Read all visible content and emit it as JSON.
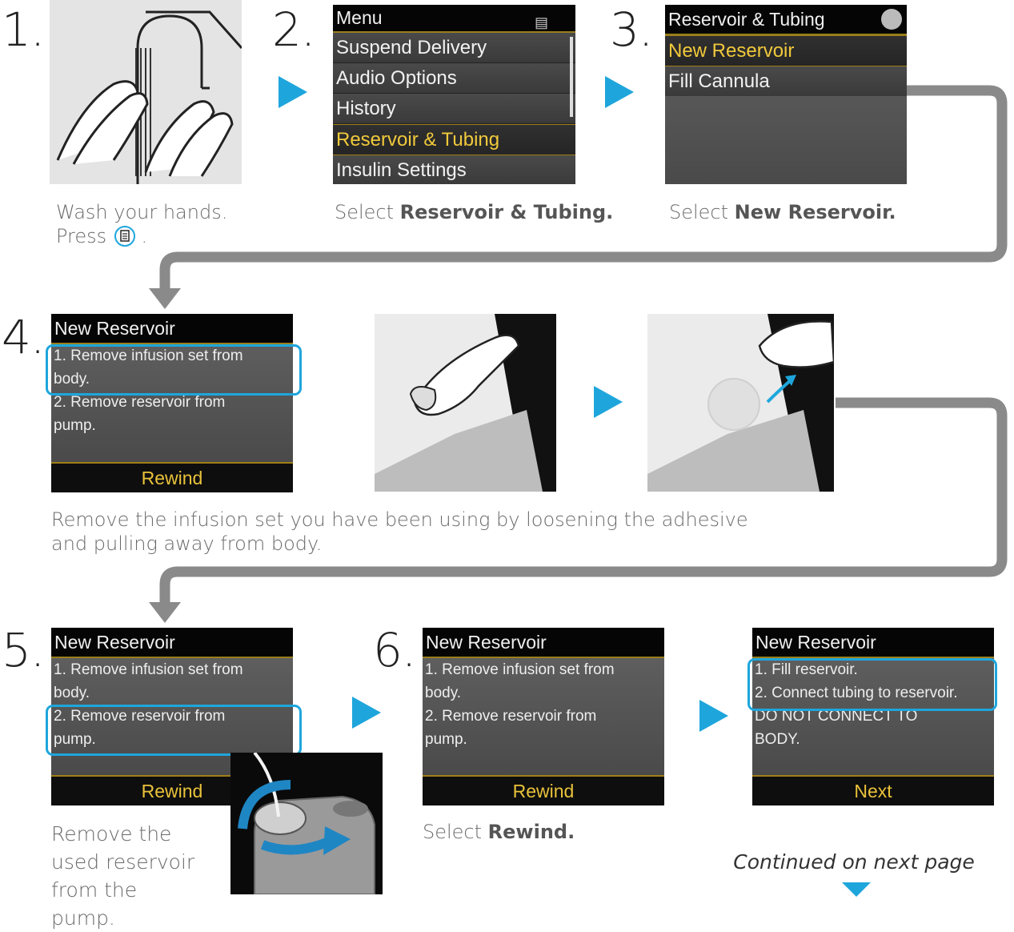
{
  "steps": {
    "s1": {
      "number": "1.",
      "caption_line1": "Wash your hands.",
      "caption_press": "Press",
      "caption_end": "."
    },
    "s2": {
      "number": "2.",
      "caption_pre": "Select ",
      "caption_bold": "Reservoir & Tubing."
    },
    "s3": {
      "number": "3.",
      "caption_pre": "Select ",
      "caption_bold": "New Reservoir."
    },
    "s4": {
      "number": "4.",
      "caption": "Remove the infusion set you have been using by loosening the adhesive and pulling away from body."
    },
    "s5": {
      "number": "5.",
      "caption": "Remove the used reservoir from the pump."
    },
    "s6": {
      "number": "6.",
      "caption_pre": "Select ",
      "caption_bold": "Rewind."
    }
  },
  "screens": {
    "menu": {
      "title": "Menu",
      "items": [
        "Suspend Delivery",
        "Audio Options",
        "History",
        "Reservoir & Tubing",
        "Insulin Settings"
      ],
      "selected": 3
    },
    "reservoir_tubing": {
      "title": "Reservoir & Tubing",
      "items": [
        "New Reservoir",
        "Fill Cannula"
      ],
      "selected": 0
    },
    "new_reservoir": {
      "title": "New Reservoir",
      "line1": "1. Remove infusion set from",
      "line2": "body.",
      "line3": "2. Remove reservoir from",
      "line4": "pump.",
      "footer": "Rewind"
    },
    "new_reservoir_fill": {
      "title": "New Reservoir",
      "line1": "1. Fill reservoir.",
      "line2": "2. Connect tubing to reservoir.",
      "line3": "DO NOT CONNECT TO",
      "line4": "BODY.",
      "footer": "Next"
    }
  },
  "continued": "Continued on next page",
  "colors": {
    "accent": "#1ea6dc",
    "connector": "#8a8a8a",
    "selected_text": "#f1c93b"
  }
}
